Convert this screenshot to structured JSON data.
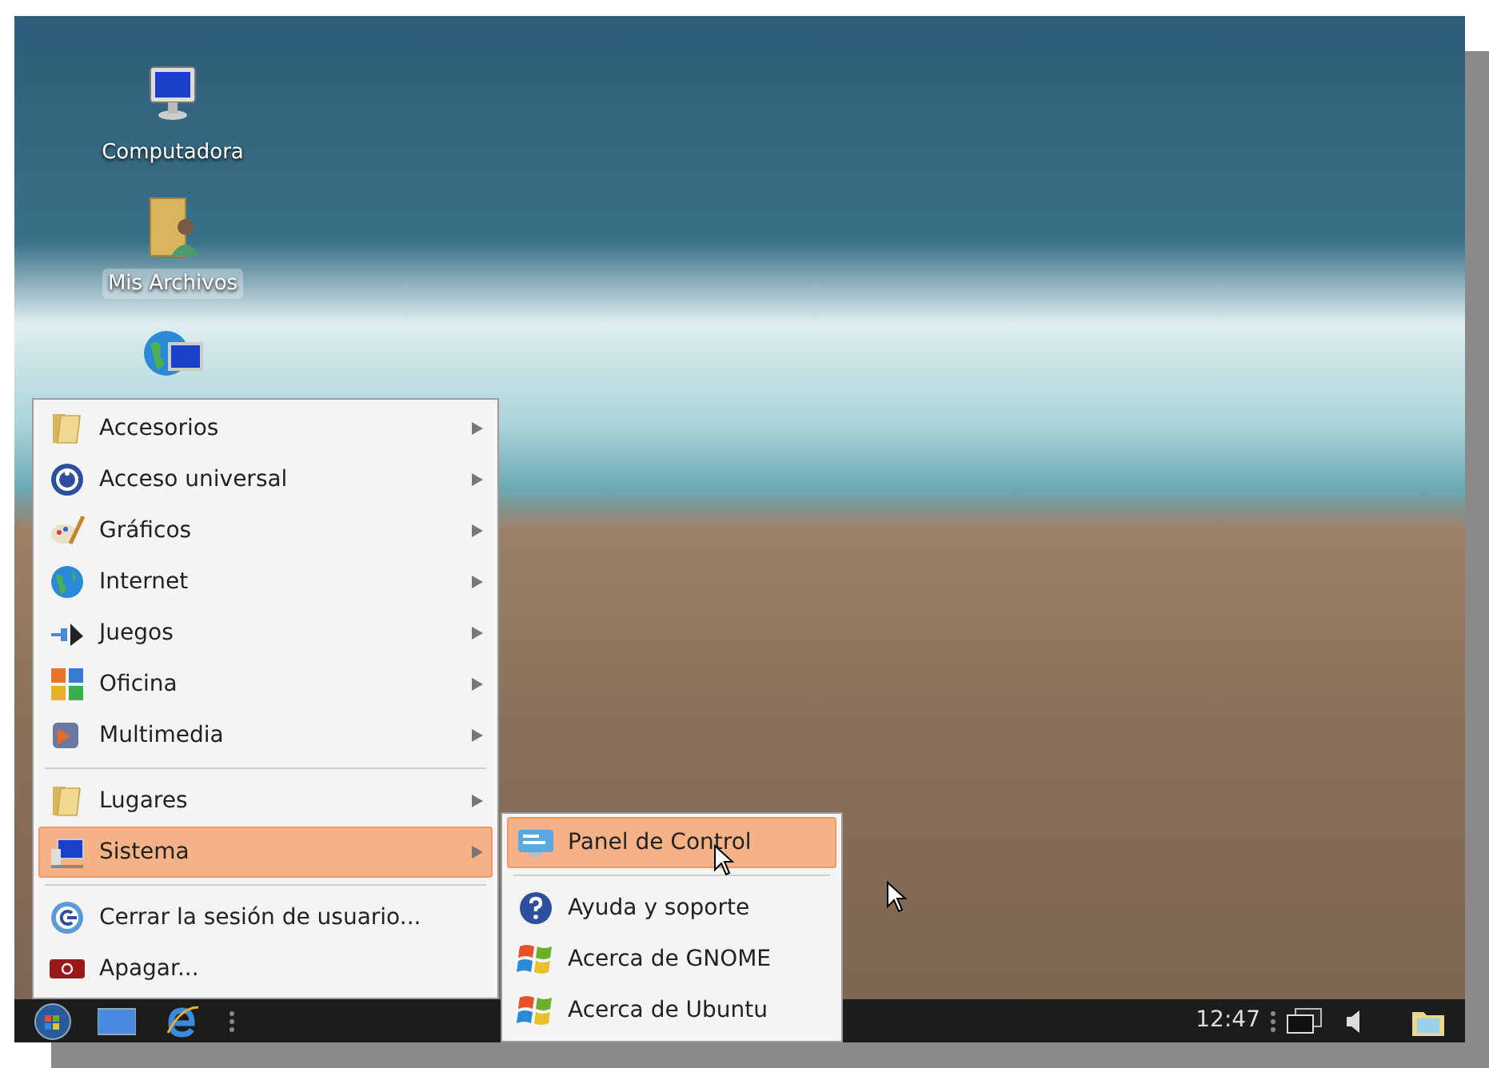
{
  "desktop_icons": [
    {
      "kind": "computer",
      "label": "Computadora",
      "selected": false
    },
    {
      "kind": "user-folder",
      "label": "Mis Archivos",
      "selected": true
    },
    {
      "kind": "network"
    }
  ],
  "menu": {
    "groups": [
      [
        {
          "kind": "folder",
          "label": "Accesorios",
          "submenu": true,
          "selected": false
        },
        {
          "kind": "accessibility",
          "label": "Acceso universal",
          "submenu": true,
          "selected": false
        },
        {
          "kind": "graphics",
          "label": "Gráficos",
          "submenu": true,
          "selected": false
        },
        {
          "kind": "globe",
          "label": "Internet",
          "submenu": true,
          "selected": false
        },
        {
          "kind": "games",
          "label": "Juegos",
          "submenu": true,
          "selected": false
        },
        {
          "kind": "office",
          "label": "Oficina",
          "submenu": true,
          "selected": false
        },
        {
          "kind": "multimedia",
          "label": "Multimedia",
          "submenu": true,
          "selected": false
        }
      ],
      [
        {
          "kind": "folder",
          "label": "Lugares",
          "submenu": true,
          "selected": false
        },
        {
          "kind": "system",
          "label": "Sistema",
          "submenu": true,
          "selected": true
        }
      ],
      [
        {
          "kind": "logout",
          "label": "Cerrar la sesión de usuario...",
          "submenu": false,
          "selected": false
        },
        {
          "kind": "power",
          "label": "Apagar...",
          "submenu": false,
          "selected": false
        }
      ]
    ]
  },
  "submenu": {
    "groups": [
      [
        {
          "kind": "control-panel",
          "label": "Panel de Control",
          "selected": true
        }
      ],
      [
        {
          "kind": "help",
          "label": "Ayuda y soporte",
          "selected": false
        },
        {
          "kind": "flag",
          "label": "Acerca de GNOME",
          "selected": false
        },
        {
          "kind": "flag",
          "label": "Acerca de Ubuntu",
          "selected": false
        }
      ]
    ]
  },
  "taskbar": {
    "clock": "12:47"
  }
}
